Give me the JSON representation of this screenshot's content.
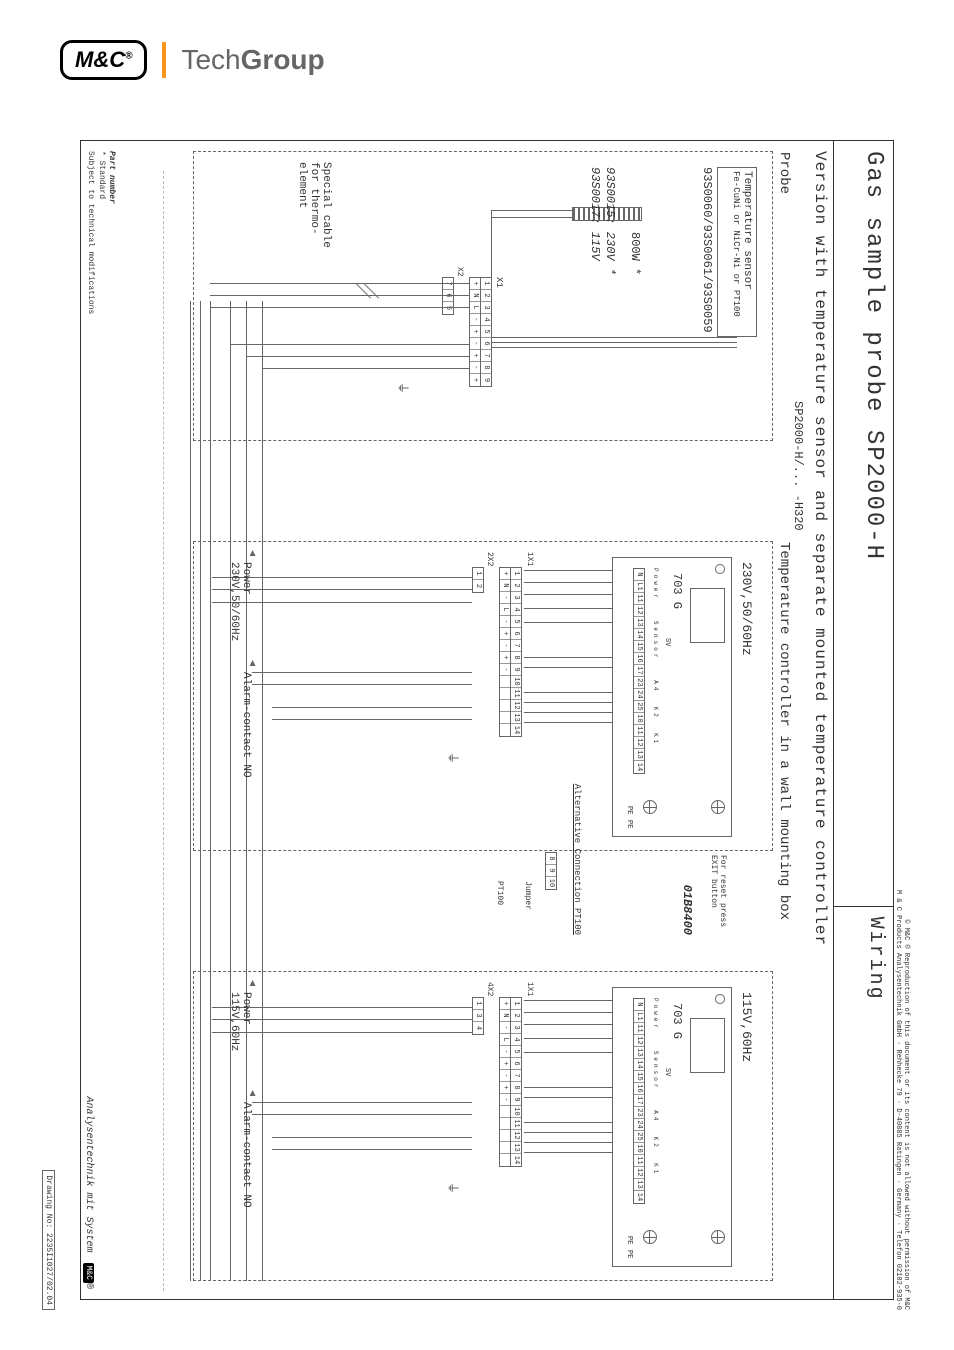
{
  "header": {
    "logo_text": "M&C",
    "logo_reg": "®",
    "brand_light": "Tech",
    "brand_bold": "Group"
  },
  "title": {
    "main": "Gas sample probe SP2000-H",
    "secondary": "Wiring",
    "subtitle": "Version with temperature sensor and separate mounted temperature controller",
    "variant": "SP2000-H/... -H320"
  },
  "probe": {
    "section_label": "Probe",
    "temp_sensor_label": "Temperature sensor",
    "temp_sensor_types": "Fe-CuNi or NiCr-Ni or PT100",
    "temp_sensor_partnos": "93S0060/93S0061/93S0059",
    "heater_power": "800W *",
    "heater_230": "93S0015: 230V *",
    "heater_115": "93S0017: 115V",
    "terminal_x1": "X1",
    "terminal_x2": "X2",
    "x1_pins": [
      "1",
      "2",
      "3",
      "4",
      "5",
      "6",
      "7",
      "8",
      "9"
    ],
    "x1_sym": [
      "+",
      "N",
      "L",
      "-",
      "+",
      "-",
      "+",
      "-",
      "+"
    ],
    "x2_pins": [
      "7",
      "6",
      "5"
    ],
    "thermo_cable": "Special cable for thermo-element"
  },
  "controller": {
    "section_label": "Temperature controller in a wall mounting box",
    "model": "703 G",
    "part_no": "01B8400",
    "reset_note": "For reset press EXIT button",
    "power_label": "Power",
    "alarm_label": "Alarm-contact NO",
    "alt_conn": "Alternative Connection PT100",
    "alt_pins": [
      "8",
      "9",
      "10"
    ],
    "jumper": "Jumper",
    "pt100_label": "PT100",
    "top_row": [
      "N",
      "L1",
      "11",
      "12",
      "13",
      "14",
      "15",
      "16",
      "17",
      "23",
      "24",
      "25",
      "10",
      "11",
      "12",
      "13",
      "14"
    ],
    "top_groups": [
      "",
      "",
      "Power",
      "Sensor",
      "A4",
      "K2",
      "K1"
    ],
    "bot_row_x1": [
      "1",
      "2",
      "3",
      "4",
      "5",
      "6",
      "7",
      "8",
      "9",
      "10",
      "11",
      "12",
      "13",
      "14"
    ],
    "bot_sym": [
      "+",
      "N",
      "-",
      "L",
      "-",
      "+",
      "-",
      "+",
      "-",
      "",
      "",
      "",
      "",
      ""
    ],
    "bot_x2_230": [
      "1",
      "2"
    ],
    "bot_x2_115": [
      "1",
      "3",
      "4"
    ],
    "pe": "PE",
    "sv": "SV"
  },
  "variants": {
    "v230": {
      "voltage_top": "230V,50/60Hz",
      "power_bottom": "230V,50/60Hz"
    },
    "v115": {
      "voltage_top": "115V,60Hz",
      "power_bottom": "115V,60Hz"
    }
  },
  "meta": {
    "copyright_1": "© M&C ® Reproduction of this document or its content is not allowed without permission of M&C",
    "copyright_2": "M & C Products Analysentechnik GmbH · Rehhecke 79 · D-40885 Ratingen · Germany · Telefon 02102-935-0",
    "company_tagline": "Analysentechnik mit System",
    "drawing_no_label": "Drawing No:",
    "drawing_no": "2235I1027/02.04",
    "footnote_partno": "Part number",
    "footnote_std": "* Standard",
    "footnote_mod": "Subject to technical modifications"
  }
}
